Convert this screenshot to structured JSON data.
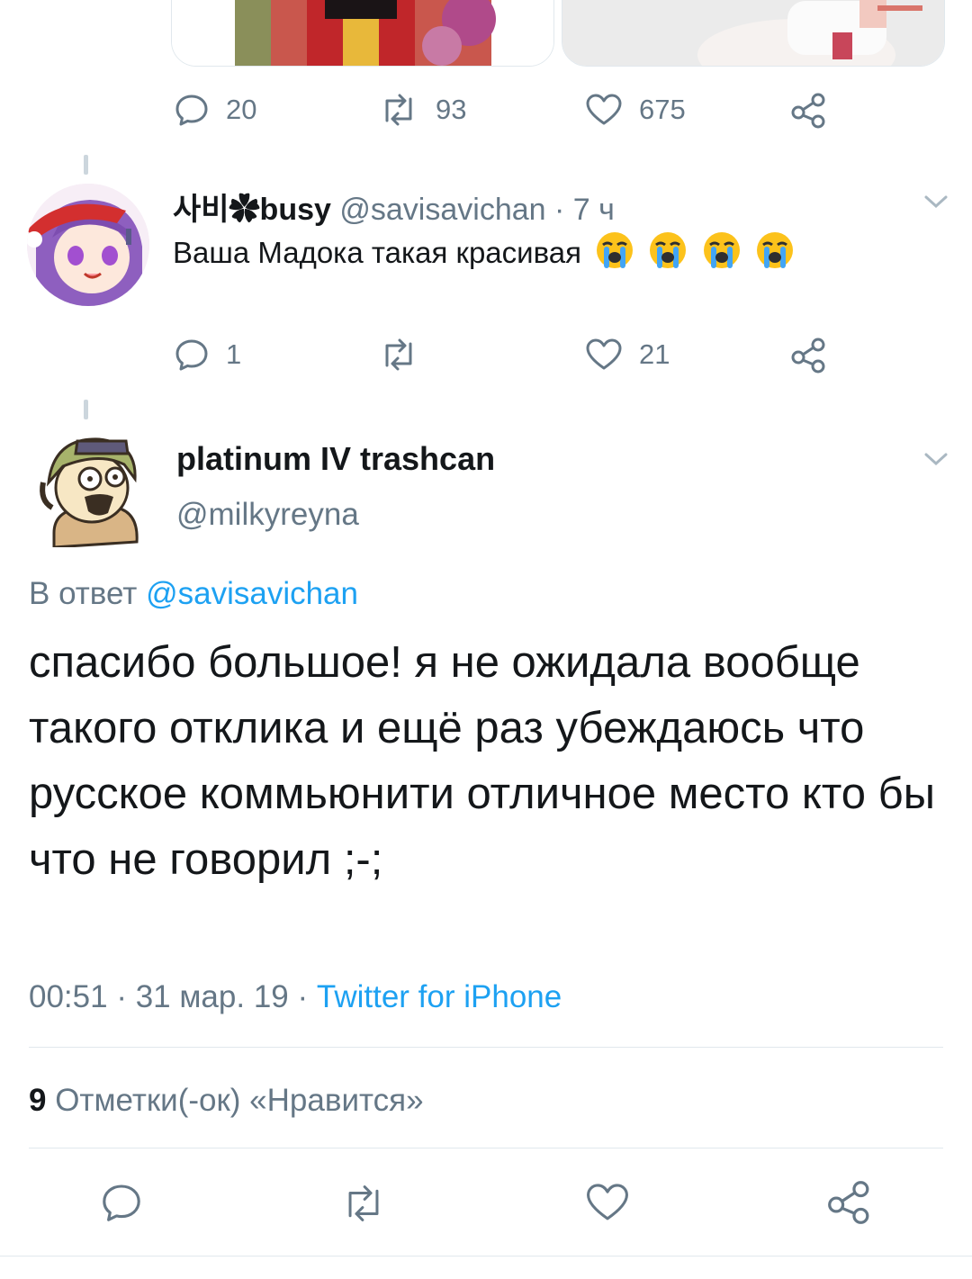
{
  "prev_tweet": {
    "actions": {
      "reply_count": "20",
      "retweet_count": "93",
      "like_count": "675"
    }
  },
  "reply_tweet": {
    "display_name": "사비✿busy",
    "handle": "@savisavichan",
    "separator": "·",
    "time": "7 ч",
    "text": "Ваша Мадока такая красивая",
    "emoji": [
      "loudly-crying-face",
      "loudly-crying-face",
      "loudly-crying-face",
      "loudly-crying-face"
    ],
    "actions": {
      "reply_count": "1",
      "retweet_count": "",
      "like_count": "21"
    }
  },
  "main_tweet": {
    "display_name": "platinum IV trashcan",
    "handle": "@milkyreyna",
    "reply_to_prefix": "В ответ",
    "reply_to_handle": "@savisavichan",
    "text": "спасибо большое! я не ожидала вообще такого отклика и ещё раз убеждаюсь что русское коммьюнити отличное место кто бы что не говорил ;-;",
    "time": "00:51",
    "date": "31 мар. 19",
    "dot": "·",
    "source": "Twitter for iPhone",
    "likes_count": "9",
    "likes_label": "Отметки(-ок) «Нравится»"
  },
  "colors": {
    "accent": "#1da1f2",
    "secondary_text": "#657786",
    "primary_text": "#14171a",
    "divider": "#e1e8ed"
  }
}
